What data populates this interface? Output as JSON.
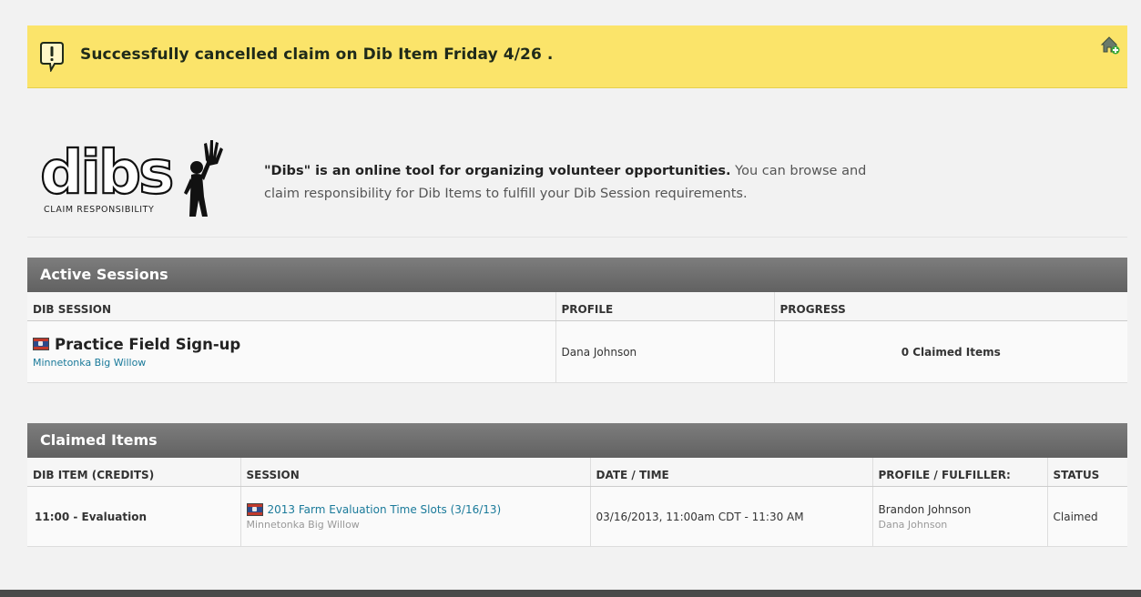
{
  "alert": {
    "message": "Successfully cancelled claim on Dib Item Friday 4/26 .",
    "icon": "exclamation-speech-icon",
    "action_icon": "home-add-icon"
  },
  "logo": {
    "wordmark": "dibs",
    "tagline": "CLAIM RESPONSIBILITY"
  },
  "intro": {
    "lead": "\"Dibs\" is an online tool for organizing volunteer opportunities.",
    "body": " You can browse and claim responsibility for Dib Items to fulfill your Dib Session requirements."
  },
  "active_sessions": {
    "title": "Active Sessions",
    "columns": [
      "DIB SESSION",
      "PROFILE",
      "PROGRESS"
    ],
    "rows": [
      {
        "session": "Practice Field Sign-up",
        "organization": "Minnetonka Big Willow",
        "profile": "Dana Johnson",
        "progress": "0 Claimed Items"
      }
    ]
  },
  "claimed_items": {
    "title": "Claimed Items",
    "columns": [
      "DIB ITEM (CREDITS)",
      "SESSION",
      "DATE / TIME",
      "PROFILE / FULFILLER:",
      "STATUS"
    ],
    "rows": [
      {
        "item": "11:00 - Evaluation",
        "session": "2013 Farm Evaluation Time Slots (3/16/13)",
        "organization": "Minnetonka Big Willow",
        "datetime": "03/16/2013, 11:00am CDT - 11:30 AM",
        "profile": "Brandon Johnson",
        "fulfiller": "Dana Johnson",
        "status": "Claimed"
      }
    ]
  },
  "colors": {
    "alert_bg": "#fbe46a",
    "section_bar": "#6e6e6e",
    "link": "#1a7a9a"
  }
}
